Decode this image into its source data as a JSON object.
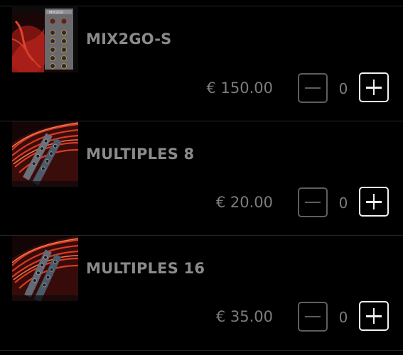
{
  "currency_color": "#7d7d7d",
  "title_color": "#8a8a8a",
  "background": "#000000",
  "products": [
    {
      "name": "MIX2GO-S",
      "price": "€ 150.00",
      "quantity": "0",
      "decrement_icon": "minus-icon",
      "increment_icon": "plus-icon"
    },
    {
      "name": "MULTIPLES 8",
      "price": "€ 20.00",
      "quantity": "0",
      "decrement_icon": "minus-icon",
      "increment_icon": "plus-icon"
    },
    {
      "name": "MULTIPLES 16",
      "price": "€ 35.00",
      "quantity": "0",
      "decrement_icon": "minus-icon",
      "increment_icon": "plus-icon"
    }
  ]
}
